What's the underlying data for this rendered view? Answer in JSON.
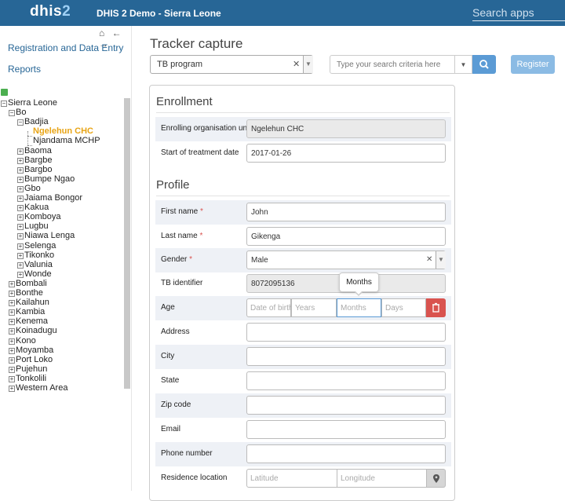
{
  "header": {
    "logo_main": "dhis",
    "logo_accent": "2",
    "title": "DHIS 2 Demo - Sierra Leone",
    "search_placeholder": "Search apps"
  },
  "sidebar": {
    "tools": "⌂ ← →",
    "links": [
      "Registration and Data Entry",
      "Reports"
    ],
    "tree": {
      "root": "Sierra Leone",
      "bo": "Bo",
      "badjia": "Badjia",
      "badjia_children": [
        "Ngelehun CHC",
        "Njandama MCHP"
      ],
      "selected": "Ngelehun CHC",
      "bo_children": [
        "Baoma",
        "Bargbe",
        "Bargbo",
        "Bumpe Ngao",
        "Gbo",
        "Jaiama Bongor",
        "Kakua",
        "Komboya",
        "Lugbu",
        "Niawa Lenga",
        "Selenga",
        "Tikonko",
        "Valunia",
        "Wonde"
      ],
      "districts": [
        "Bombali",
        "Bonthe",
        "Kailahun",
        "Kambia",
        "Kenema",
        "Koinadugu",
        "Kono",
        "Moyamba",
        "Port Loko",
        "Pujehun",
        "Tonkolili",
        "Western Area"
      ]
    }
  },
  "main": {
    "page_title": "Tracker capture",
    "program": "TB program",
    "search_placeholder": "Type your search criteria here",
    "register_label": "Register",
    "enrollment": {
      "title": "Enrollment",
      "org_unit_label": "Enrolling organisation unit",
      "org_unit_value": "Ngelehun CHC",
      "start_date_label": "Start of treatment date",
      "start_date_value": "2017-01-26"
    },
    "profile": {
      "title": "Profile",
      "first_name_label": "First name",
      "first_name_value": "John",
      "last_name_label": "Last name",
      "last_name_value": "Gikenga",
      "gender_label": "Gender",
      "gender_value": "Male",
      "tb_id_label": "TB identifier",
      "tb_id_value": "8072095136",
      "age_label": "Age",
      "age_placeholders": {
        "dob": "Date of birth",
        "years": "Years",
        "months": "Months",
        "days": "Days"
      },
      "tooltip": "Months",
      "address_label": "Address",
      "city_label": "City",
      "state_label": "State",
      "zip_label": "Zip code",
      "email_label": "Email",
      "phone_label": "Phone number",
      "residence_label": "Residence location",
      "latitude_placeholder": "Latitude",
      "longitude_placeholder": "Longitude",
      "required_mark": "*"
    }
  },
  "colors": {
    "header_bg": "#276696",
    "primary": "#5b9bd5",
    "register": "#8bbbe4",
    "danger": "#d9534f",
    "selected_org": "#e8a415",
    "row_shade": "#eef1f6"
  }
}
